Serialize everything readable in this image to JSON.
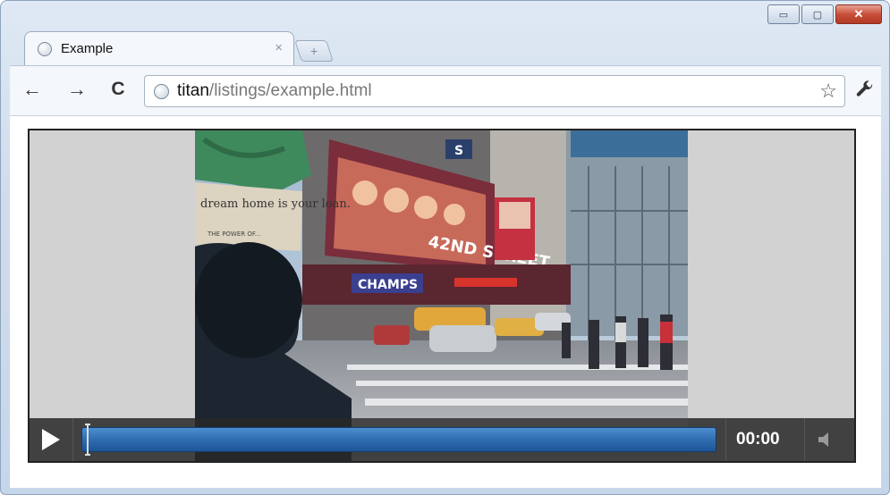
{
  "window": {
    "minimize_glyph": "▭",
    "maximize_glyph": "▢",
    "close_glyph": "✕"
  },
  "tab": {
    "title": "Example",
    "close_glyph": "×"
  },
  "new_tab_glyph": "+",
  "toolbar": {
    "back_glyph": "←",
    "forward_glyph": "→",
    "reload_glyph": "C",
    "star_glyph": "☆",
    "wrench_glyph": "🔧"
  },
  "address": {
    "host": "titan",
    "path": "/listings/example.html"
  },
  "billboards": {
    "street_sign": "42ND STREET",
    "store_sign": "CHAMPS",
    "poster_text": "dream home is your loan.",
    "poster_small": "THE POWER OF...",
    "building_letter": "S"
  },
  "player": {
    "time": "00:00",
    "progress_fraction": 0.0
  },
  "colors": {
    "progress": "#2f6db0",
    "titlebar": "#cfdcec",
    "close_button": "#c8503a"
  }
}
